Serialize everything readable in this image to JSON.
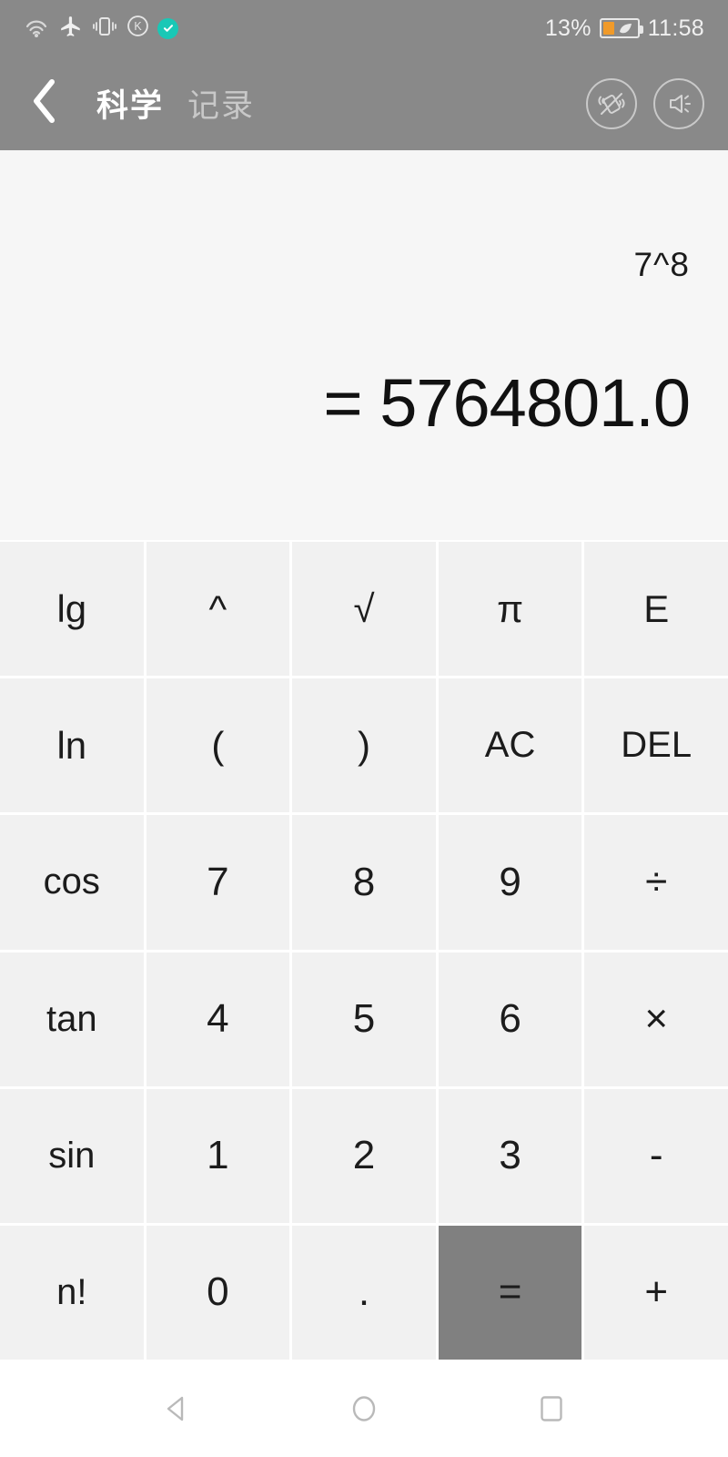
{
  "statusbar": {
    "icons": [
      "wifi-hotspot-icon",
      "airplane-mode-icon",
      "vibrate-icon",
      "k-circle-icon",
      "verified-check-icon"
    ],
    "battery_percent": "13%",
    "battery_icon": "battery-saver-icon",
    "time": "11:58",
    "bg_color": "#898989"
  },
  "header": {
    "back_icon": "back-chevron-icon",
    "tabs": [
      {
        "label": "科学",
        "active": true
      },
      {
        "label": "记录",
        "active": false
      }
    ],
    "actions": [
      {
        "name": "vibrate-off-icon"
      },
      {
        "name": "sound-on-icon"
      }
    ],
    "bg_color": "#898989"
  },
  "display": {
    "expression": "7^8",
    "result": "= 5764801.0",
    "bg_color": "#f6f6f6"
  },
  "keypad": {
    "key_bg": "#f1f1f1",
    "equals_bg": "#808080",
    "rows": [
      [
        {
          "label": "lg",
          "name": "key-log10",
          "kind": "fn"
        },
        {
          "label": "^",
          "name": "key-power",
          "kind": "fn"
        },
        {
          "label": "√",
          "name": "key-sqrt",
          "kind": "fn"
        },
        {
          "label": "π",
          "name": "key-pi",
          "kind": "fn"
        },
        {
          "label": "E",
          "name": "key-exponent",
          "kind": "fn"
        }
      ],
      [
        {
          "label": "ln",
          "name": "key-ln",
          "kind": "fn"
        },
        {
          "label": "(",
          "name": "key-paren-open",
          "kind": "fn"
        },
        {
          "label": ")",
          "name": "key-paren-close",
          "kind": "fn"
        },
        {
          "label": "AC",
          "name": "key-all-clear",
          "kind": "small"
        },
        {
          "label": "DEL",
          "name": "key-delete",
          "kind": "small"
        }
      ],
      [
        {
          "label": "cos",
          "name": "key-cos",
          "kind": "small"
        },
        {
          "label": "7",
          "name": "key-7",
          "kind": "num"
        },
        {
          "label": "8",
          "name": "key-8",
          "kind": "num"
        },
        {
          "label": "9",
          "name": "key-9",
          "kind": "num"
        },
        {
          "label": "÷",
          "name": "key-divide",
          "kind": "op"
        }
      ],
      [
        {
          "label": "tan",
          "name": "key-tan",
          "kind": "small"
        },
        {
          "label": "4",
          "name": "key-4",
          "kind": "num"
        },
        {
          "label": "5",
          "name": "key-5",
          "kind": "num"
        },
        {
          "label": "6",
          "name": "key-6",
          "kind": "num"
        },
        {
          "label": "×",
          "name": "key-multiply",
          "kind": "op"
        }
      ],
      [
        {
          "label": "sin",
          "name": "key-sin",
          "kind": "small"
        },
        {
          "label": "1",
          "name": "key-1",
          "kind": "num"
        },
        {
          "label": "2",
          "name": "key-2",
          "kind": "num"
        },
        {
          "label": "3",
          "name": "key-3",
          "kind": "num"
        },
        {
          "label": "-",
          "name": "key-minus",
          "kind": "op"
        }
      ],
      [
        {
          "label": "n!",
          "name": "key-factorial",
          "kind": "small"
        },
        {
          "label": "0",
          "name": "key-0",
          "kind": "num"
        },
        {
          "label": ".",
          "name": "key-decimal",
          "kind": "num"
        },
        {
          "label": "=",
          "name": "key-equals",
          "kind": "equals"
        },
        {
          "label": "+",
          "name": "key-plus",
          "kind": "op"
        }
      ]
    ]
  },
  "navbar": {
    "items": [
      {
        "name": "android-back-icon"
      },
      {
        "name": "android-home-icon"
      },
      {
        "name": "android-recents-icon"
      }
    ]
  }
}
